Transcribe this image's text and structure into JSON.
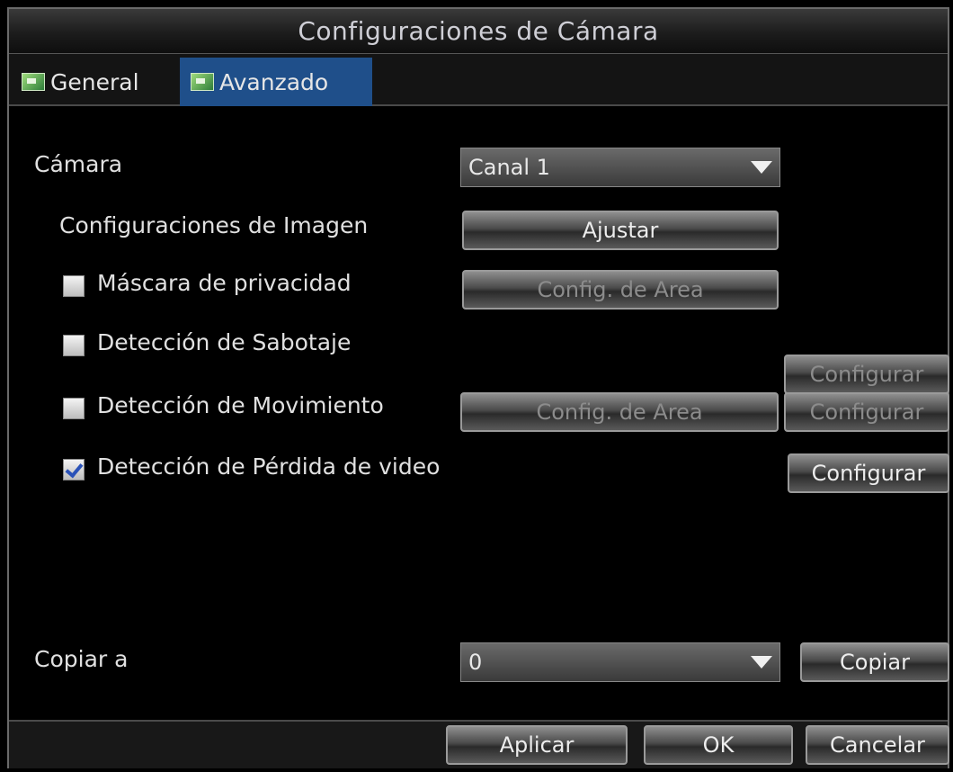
{
  "window": {
    "title": "Configuraciones de Cámara"
  },
  "tabs": [
    {
      "label": "General",
      "icon": "picture-icon",
      "active": false
    },
    {
      "label": "Avanzado",
      "icon": "picture-icon",
      "active": true
    }
  ],
  "camera": {
    "label": "Cámara",
    "selected": "Canal 1"
  },
  "image_settings": {
    "label": "Configuraciones de Imagen",
    "button": "Ajustar"
  },
  "privacy_mask": {
    "label": "Máscara de privacidad",
    "checked": false,
    "area_button": "Config. de Area"
  },
  "tamper_detection": {
    "label": "Detección de Sabotaje",
    "checked": false,
    "config_button": "Configurar"
  },
  "motion_detection": {
    "label": "Detección de Movimiento",
    "checked": false,
    "area_button": "Config. de Area",
    "config_button": "Configurar"
  },
  "video_loss": {
    "label": "Detección de Pérdida de video",
    "checked": true,
    "config_button": "Configurar"
  },
  "copy": {
    "label": "Copiar a",
    "selected": "0",
    "button": "Copiar"
  },
  "footer": {
    "apply": "Aplicar",
    "ok": "OK",
    "cancel": "Cancelar"
  },
  "colors": {
    "active_tab": "#1f4f8a",
    "checkbox_check": "#2a52b8"
  }
}
